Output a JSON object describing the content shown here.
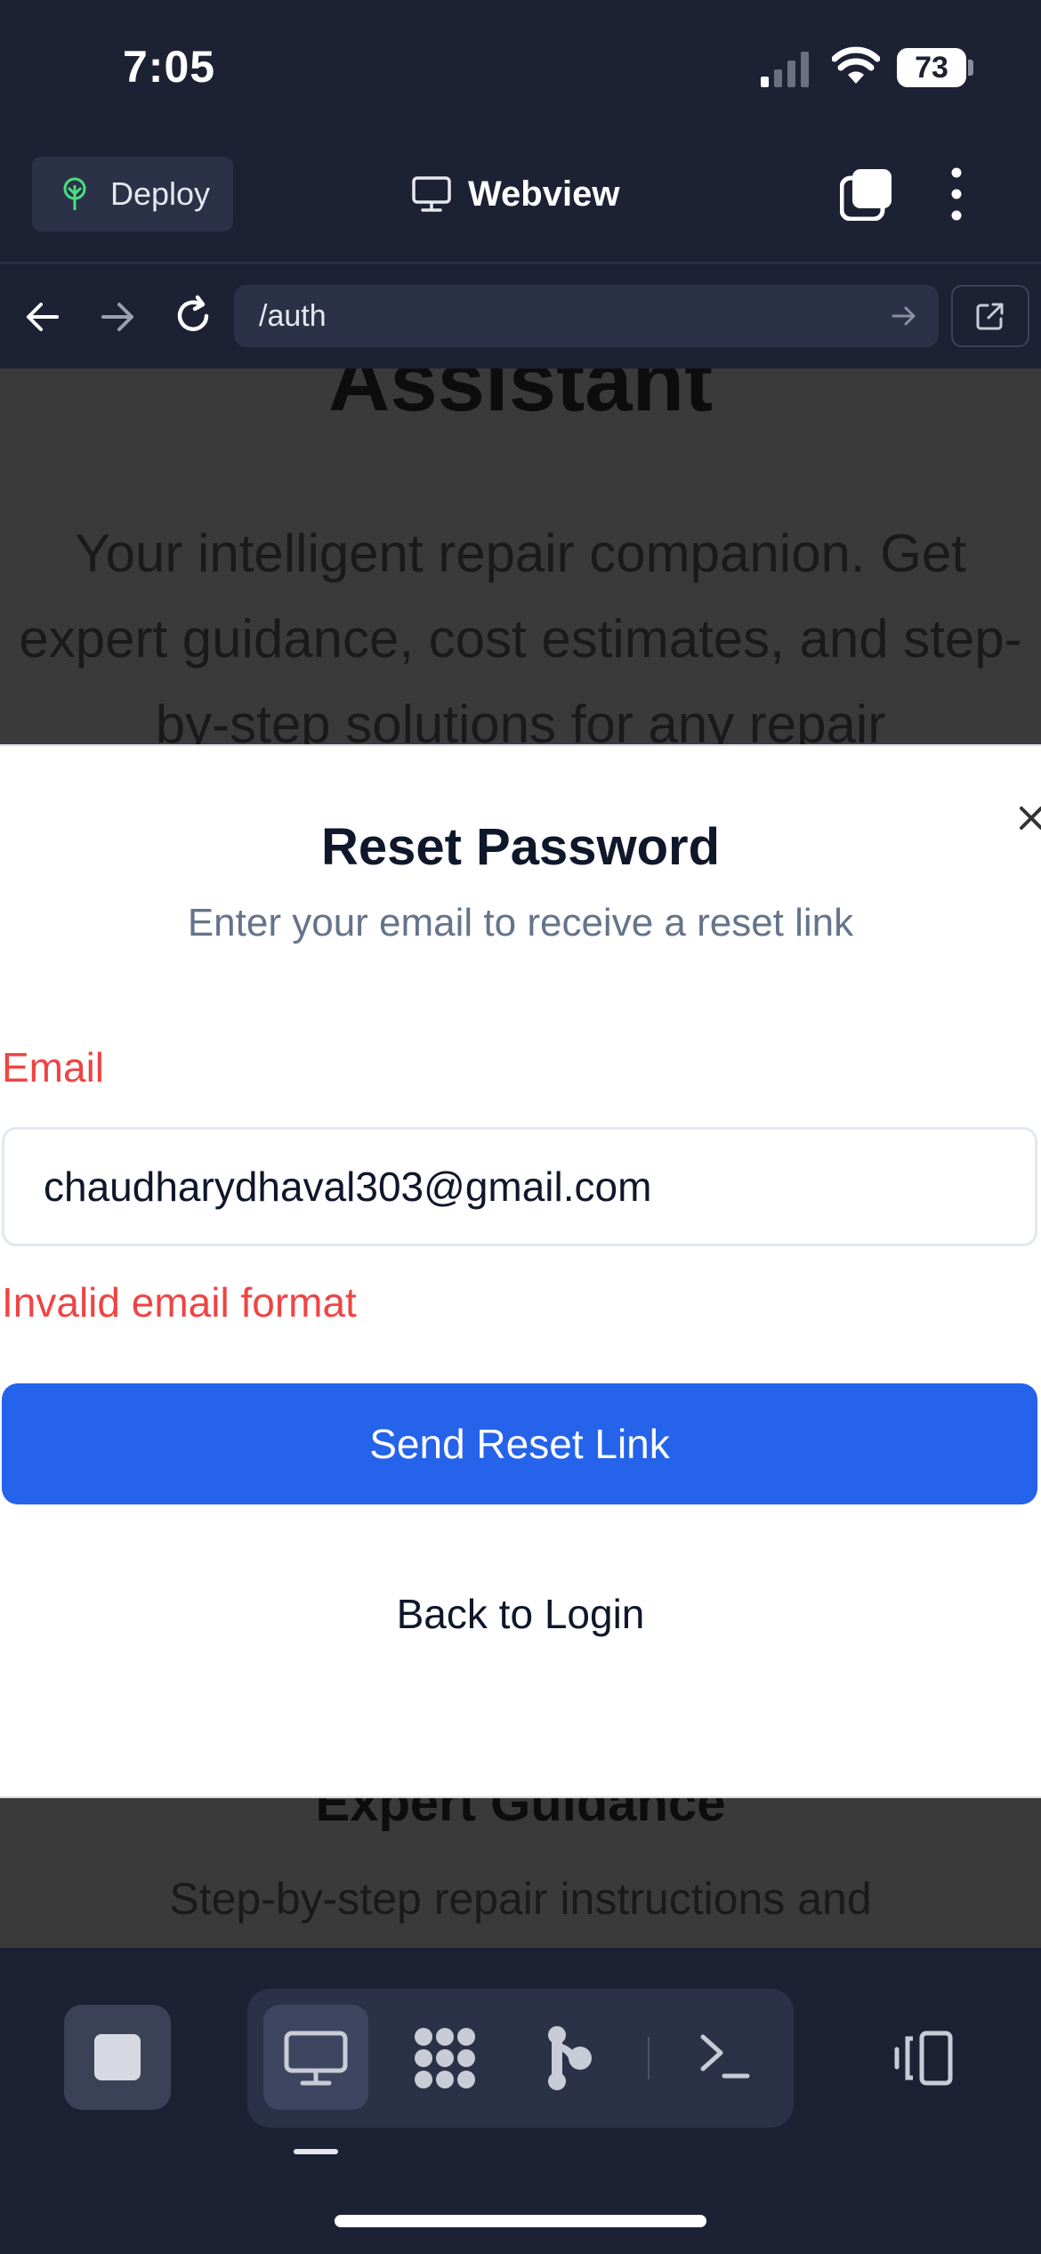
{
  "status": {
    "time": "7:05",
    "battery": "73"
  },
  "toolbar": {
    "deploy_label": "Deploy",
    "title": "Webview"
  },
  "address": {
    "url": "/auth"
  },
  "page_background": {
    "heading": "Assistant",
    "paragraph": "Your intelligent repair companion. Get expert guidance, cost estimates, and step-by-step solutions for any repair",
    "section_heading": "Expert Guidance",
    "section_text": "Step-by-step repair instructions and"
  },
  "modal": {
    "title": "Reset Password",
    "subtitle": "Enter your email to receive a reset link",
    "email_label": "Email",
    "email_value": "chaudharydhaval303@gmail.com",
    "error": "Invalid email format",
    "submit_label": "Send Reset Link",
    "back_label": "Back to Login",
    "close_symbol": "×"
  },
  "colors": {
    "accent": "#2563eb",
    "error": "#ef4444",
    "chrome_bg": "#1c2133",
    "chrome_surface": "#2b3247"
  },
  "icons": [
    "deploy-tree-icon",
    "monitor-icon",
    "tabs-icon",
    "more-vertical-icon",
    "arrow-left-icon",
    "arrow-right-icon",
    "reload-icon",
    "external-link-icon",
    "stop-icon",
    "packager-icon",
    "git-icon",
    "shell-icon",
    "devices-icon"
  ]
}
